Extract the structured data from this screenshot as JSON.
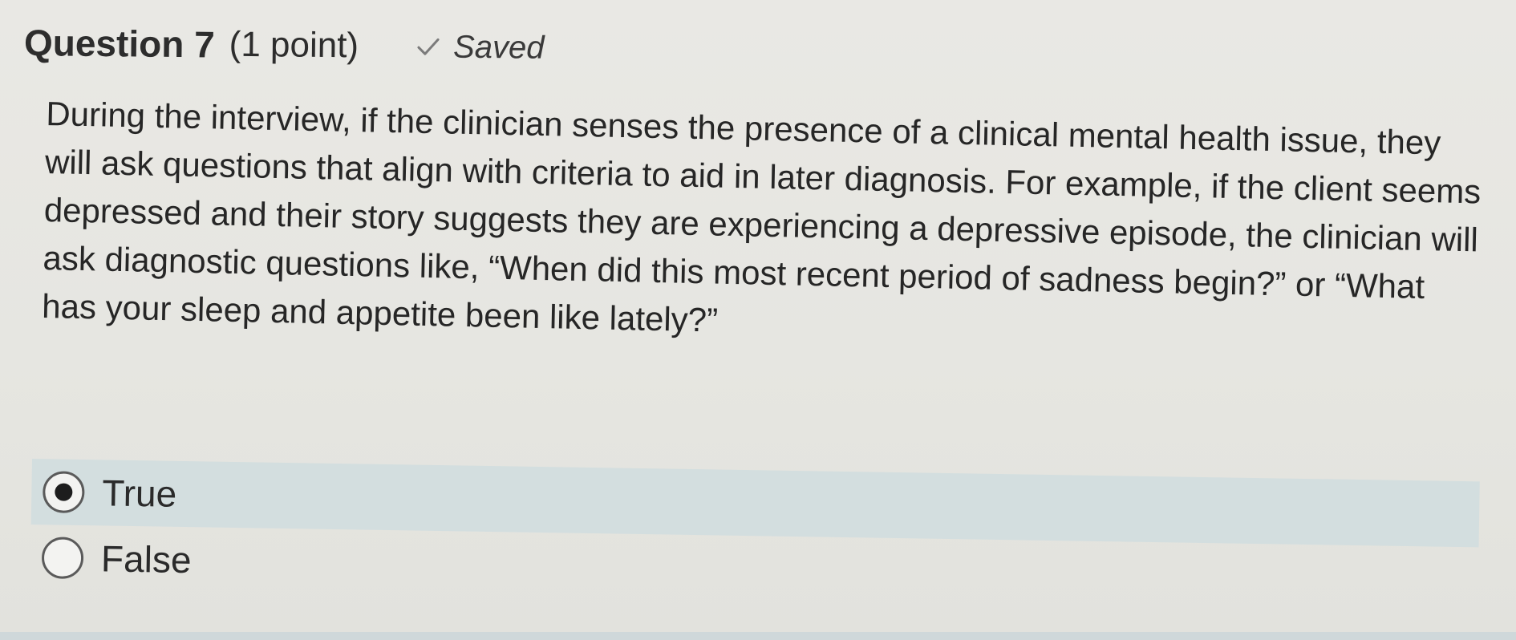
{
  "question": {
    "title": "Question 7",
    "points": "(1 point)",
    "status": "Saved",
    "status_icon": "check-icon",
    "text": "During the interview, if the clinician senses the presence of a clinical mental health issue, they will ask questions that align with criteria to aid in later diagnosis. For example, if the client seems depressed and their story suggests they are experiencing a depressive episode, the clinician will ask diagnostic questions like, “When did this most recent period of sadness begin?” or “What has your sleep and appetite been like lately?”"
  },
  "answers": {
    "selected": "True",
    "options": [
      {
        "label": "True",
        "selected": true
      },
      {
        "label": "False",
        "selected": false
      }
    ]
  },
  "colors": {
    "selected_row_bg": "#d3dedf",
    "page_bg": "#e8e8e4"
  }
}
